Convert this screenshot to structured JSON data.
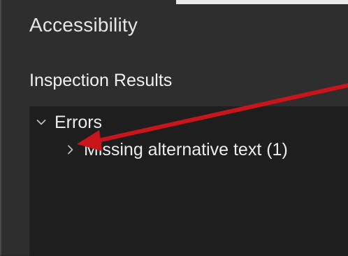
{
  "panel": {
    "title": "Accessibility"
  },
  "inspection": {
    "section_title": "Inspection Results",
    "tree": {
      "errors": {
        "label": "Errors",
        "expanded": true
      },
      "missing_alt_text": {
        "label": "Missing alternative text (1)",
        "expanded": false
      }
    }
  },
  "icons": {
    "expanded": "chevron-down-icon",
    "collapsed": "chevron-right-icon",
    "annotation": "red-arrow-icon"
  },
  "colors": {
    "panel_bg": "#2e2e2e",
    "results_bg": "#1f1e1f",
    "text": "#ececec",
    "annotation_arrow": "#c8141a"
  }
}
